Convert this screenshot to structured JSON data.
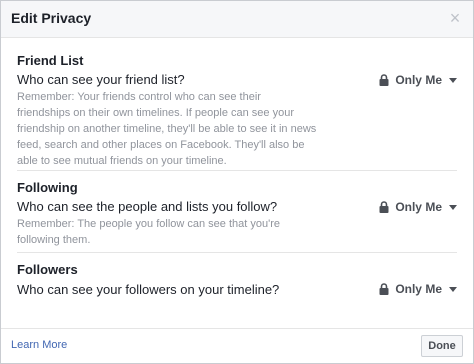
{
  "dialog": {
    "title": "Edit Privacy",
    "close_icon": "close-icon"
  },
  "sections": {
    "friend_list": {
      "title": "Friend List",
      "question": "Who can see your friend list?",
      "remember": "Remember: Your friends control who can see their friendships on their own timelines. If people can see your friendship on another timeline, they'll be able to see it in news feed, search and other places on Facebook. They'll also be able to see mutual friends on your timeline.",
      "audience": "Only Me"
    },
    "following": {
      "title": "Following",
      "question": "Who can see the people and lists you follow?",
      "remember": "Remember: The people you follow can see that you're following them.",
      "audience": "Only Me"
    },
    "followers": {
      "title": "Followers",
      "question": "Who can see your followers on your timeline?",
      "audience": "Only Me"
    }
  },
  "footer": {
    "learn_more": "Learn More",
    "done": "Done"
  },
  "colors": {
    "link": "#4267b2",
    "text": "#1d2129",
    "secondary_text": "#90949c",
    "header_bg": "#f6f7f9"
  }
}
